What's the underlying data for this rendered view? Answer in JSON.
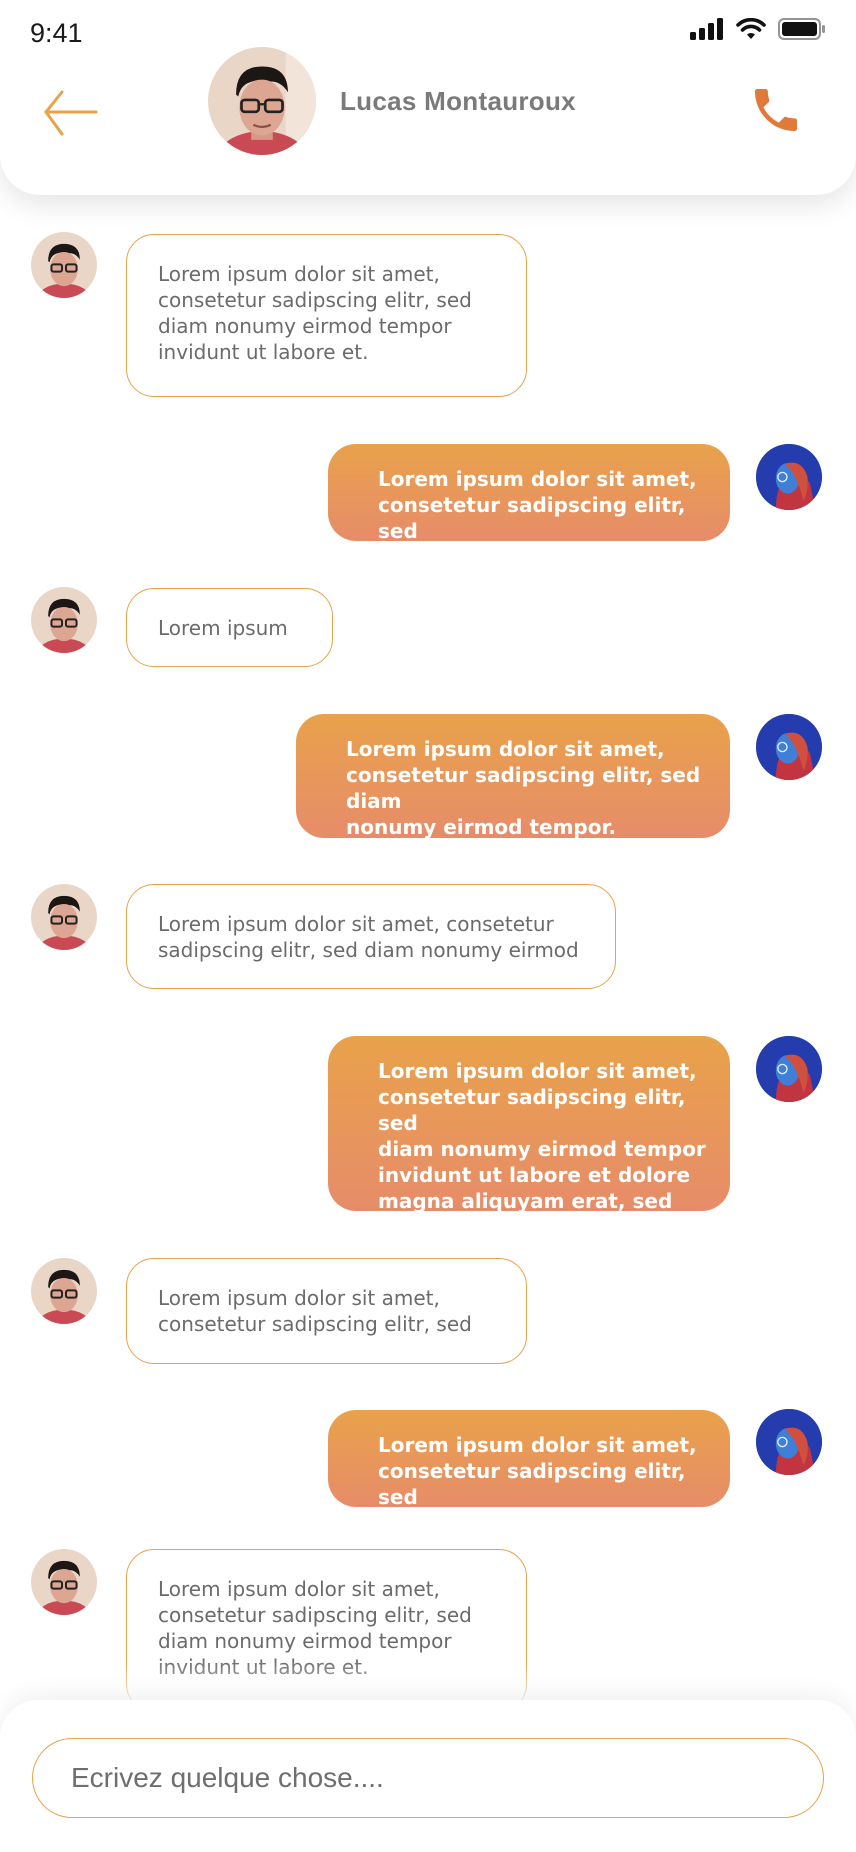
{
  "status_bar": {
    "time": "9:41",
    "icons": [
      "signal-icon",
      "wifi-icon",
      "battery-icon"
    ]
  },
  "header": {
    "back_icon": "arrow-left-icon",
    "contact_name": "Lucas Montauroux",
    "call_icon": "phone-icon"
  },
  "colors": {
    "accent": "#e8a24a",
    "accent_end": "#e78c6a",
    "incoming_text": "#6b6b6b",
    "outgoing_text": "#ffffff"
  },
  "messages": [
    {
      "sender": "contact",
      "lines": [
        "Lorem ipsum dolor sit amet,",
        "consetetur sadipscing elitr, sed",
        "diam nonumy eirmod tempor",
        "invidunt ut labore et."
      ]
    },
    {
      "sender": "me",
      "lines": [
        "Lorem ipsum dolor sit amet,",
        "consetetur sadipscing elitr, sed"
      ]
    },
    {
      "sender": "contact",
      "lines": [
        "Lorem ipsum"
      ]
    },
    {
      "sender": "me",
      "lines": [
        "Lorem ipsum dolor sit amet,",
        "consetetur sadipscing elitr, sed diam",
        "nonumy eirmod tempor."
      ]
    },
    {
      "sender": "contact",
      "lines": [
        "Lorem ipsum dolor sit amet, consetetur",
        "sadipscing elitr, sed diam nonumy eirmod"
      ]
    },
    {
      "sender": "me",
      "lines": [
        "Lorem ipsum dolor sit amet,",
        "consetetur sadipscing elitr, sed",
        "diam nonumy eirmod tempor",
        "invidunt ut labore et dolore",
        "magna aliquyam erat, sed diam."
      ]
    },
    {
      "sender": "contact",
      "lines": [
        "Lorem ipsum dolor sit amet,",
        "consetetur sadipscing elitr, sed"
      ]
    },
    {
      "sender": "me",
      "lines": [
        "Lorem ipsum dolor sit amet,",
        "consetetur sadipscing elitr, sed"
      ]
    },
    {
      "sender": "contact",
      "lines": [
        "Lorem ipsum dolor sit amet,",
        "consetetur sadipscing elitr, sed",
        "diam nonumy eirmod tempor",
        "invidunt ut labore et."
      ]
    }
  ],
  "composer": {
    "placeholder": "Ecrivez quelque chose...."
  }
}
